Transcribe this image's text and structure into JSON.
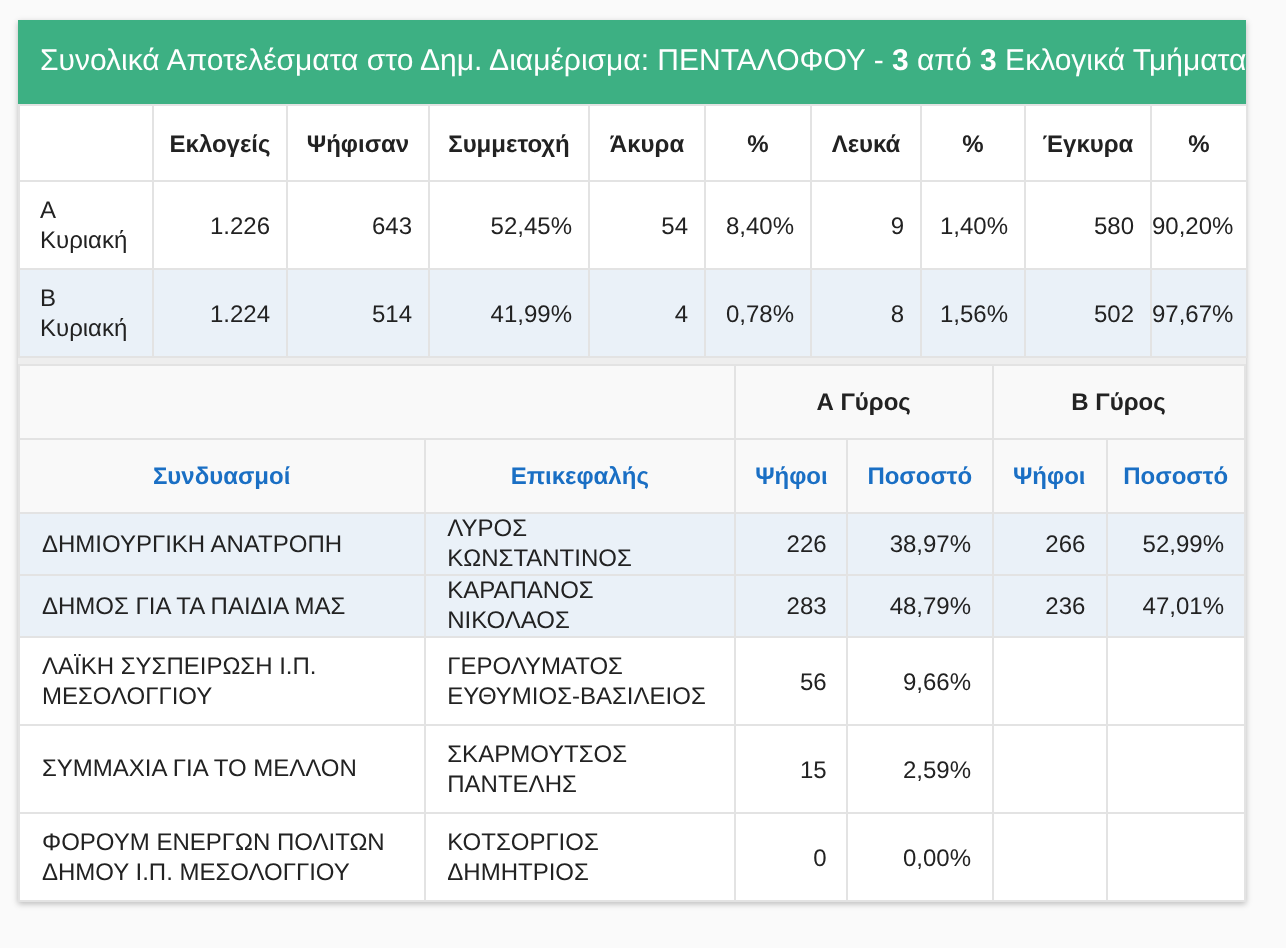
{
  "panel": {
    "title": "Συνολικά Αποτελέσματα στο Δημ. Διαμέρισμα: ΠΕΝΤΑΛΟΦΟΥ - **3** από **3** Εκλογικά Τμήματα"
  },
  "turnout": {
    "columns": [
      "Εκλογείς",
      "Ψήφισαν",
      "Συμμετοχή",
      "Άκυρα",
      "%",
      "Λευκά",
      "%",
      "Έγκυρα",
      "%"
    ],
    "rows": [
      {
        "label": "Α Κυριακή",
        "highlighted": false,
        "values": [
          "1.226",
          "643",
          "52,45%",
          "54",
          "8,40%",
          "9",
          "1,40%",
          "580",
          "90,20%"
        ]
      },
      {
        "label": "Β Κυριακή",
        "highlighted": true,
        "values": [
          "1.224",
          "514",
          "41,99%",
          "4",
          "0,78%",
          "8",
          "1,56%",
          "502",
          "97,67%"
        ]
      }
    ]
  },
  "results": {
    "round_headers": [
      "Α Γύρος",
      "Β Γύρος"
    ],
    "columns": [
      "Συνδυασμοί",
      "Επικεφαλής",
      "Ψήφοι",
      "Ποσοστό",
      "Ψήφοι",
      "Ποσοστό"
    ],
    "rows": [
      {
        "list": "ΔΗΜΙΟΥΡΓΙΚΗ ΑΝΑΤΡΟΠΗ",
        "leader": "ΛΥΡΟΣ ΚΩΝΣΤΑΝΤΙΝΟΣ",
        "highlighted": true,
        "round_a": [
          "226",
          "38,97%"
        ],
        "round_b": [
          "266",
          "52,99%"
        ]
      },
      {
        "list": "ΔΗΜΟΣ ΓΙΑ ΤΑ ΠΑΙΔΙΑ ΜΑΣ",
        "leader": "ΚΑΡΑΠΑΝΟΣ ΝΙΚΟΛΑΟΣ",
        "highlighted": true,
        "round_a": [
          "283",
          "48,79%"
        ],
        "round_b": [
          "236",
          "47,01%"
        ]
      },
      {
        "list": "ΛΑΪΚΗ ΣΥΣΠΕΙΡΩΣΗ Ι.Π. ΜΕΣΟΛΟΓΓΙΟΥ",
        "leader": "ΓΕΡΟΛΥΜΑΤΟΣ ΕΥΘΥΜΙΟΣ-ΒΑΣΙΛΕΙΟΣ",
        "highlighted": false,
        "round_a": [
          "56",
          "9,66%"
        ]
      },
      {
        "list": "ΣΥΜΜΑΧΙΑ ΓΙΑ ΤΟ ΜΕΛΛΟΝ",
        "leader": "ΣΚΑΡΜΟΥΤΣΟΣ ΠΑΝΤΕΛΗΣ",
        "highlighted": false,
        "round_a": [
          "15",
          "2,59%"
        ]
      },
      {
        "list": "ΦΟΡΟΥΜ ΕΝΕΡΓΩΝ ΠΟΛΙΤΩΝ ΔΗΜΟΥ Ι.Π. ΜΕΣΟΛΟΓΓΙΟΥ",
        "leader": "ΚΟΤΣΟΡΓΙΟΣ ΔΗΜΗΤΡΙΟΣ",
        "highlighted": false,
        "round_a": [
          "0",
          "0,00%"
        ]
      }
    ]
  }
}
